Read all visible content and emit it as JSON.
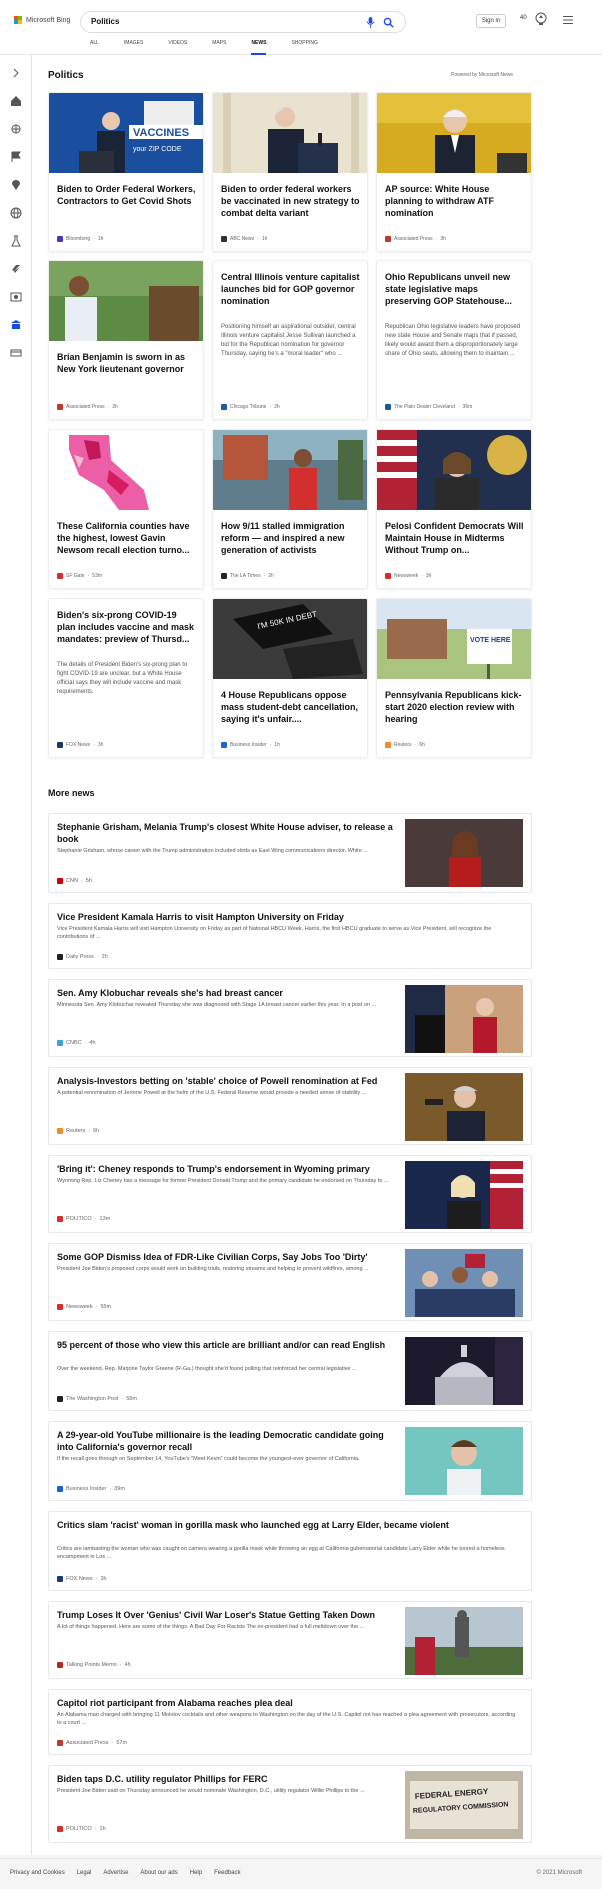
{
  "header": {
    "brand": "Microsoft Bing",
    "query": "Politics",
    "signin": "Sign in",
    "rewards": "40",
    "tabs": [
      "ALL",
      "IMAGES",
      "VIDEOS",
      "MAPS",
      "NEWS",
      "SHOPPING"
    ],
    "active_tab": "NEWS"
  },
  "section": {
    "title": "Politics",
    "powered": "Powered by Microsoft News"
  },
  "cards": [
    {
      "title": "Biden to Order Federal Workers, Contractors to Get Covid Shots",
      "source": "Bloomberg",
      "time": "1h",
      "color": "#4a38c9",
      "img": "vaccine",
      "snippet": ""
    },
    {
      "title": "Biden to order federal workers be vaccinated in new strategy to combat delta variant",
      "source": "ABC News",
      "time": "1h",
      "color": "#333",
      "img": "podium",
      "snippet": ""
    },
    {
      "title": "AP source: White House planning to withdraw ATF nomination",
      "source": "Associated Press",
      "time": "3h",
      "color": "#c0392b",
      "img": "gold",
      "snippet": ""
    },
    {
      "title": "Brian Benjamin is sworn in as New York lieutenant governor",
      "source": "Associated Press",
      "time": "2h",
      "color": "#c0392b",
      "img": "green",
      "snippet": ""
    },
    {
      "title": "Central Illinois venture capitalist launches bid for GOP governor nomination",
      "source": "Chicago Tribune",
      "time": "2h",
      "color": "#1e5aa8",
      "img": "",
      "snippet": "Positioning himself an aspirational outsider, central Illinois venture capitalist Jesse Sullivan launched a bid for the Republican nomination for governor Thursday, saying he's a \"moral leader\" who ..."
    },
    {
      "title": "Ohio Republicans unveil new state legislative maps preserving GOP Statehouse...",
      "source": "The Plain Dealer Cleveland",
      "time": "36m",
      "color": "#1e5aa8",
      "img": "",
      "snippet": "Republican Ohio legislative leaders have proposed new state House and Senate maps that if passed, likely would award them a disproportionately large share of Ohio seats, allowing them to maintain ..."
    },
    {
      "title": "These California counties have the highest, lowest Gavin Newsom recall election turno...",
      "source": "SF Gate",
      "time": "53m",
      "color": "#d62f2f",
      "img": "map",
      "snippet": ""
    },
    {
      "title": "How 9/11 stalled immigration reform — and inspired a new generation of activists",
      "source": "The LA Times",
      "time": "2h",
      "color": "#222",
      "img": "mural",
      "snippet": ""
    },
    {
      "title": "Pelosi Confident Democrats Will Maintain House in Midterms Without Trump on...",
      "source": "Newsweek",
      "time": "3h",
      "color": "#e0292b",
      "img": "flag",
      "snippet": ""
    },
    {
      "title": "Biden's six-prong COVID-19 plan includes vaccine and mask mandates: preview of Thursd...",
      "source": "FOX News",
      "time": "3h",
      "color": "#1b3a6b",
      "img": "",
      "snippet": "The details of President Biden's six-prong plan to fight COVID-19 are unclear, but a White House official says they will include vaccine and mask requirements."
    },
    {
      "title": "4 House Republicans oppose mass student-debt cancellation, saying it's unfair....",
      "source": "Business Insider",
      "time": "1h",
      "color": "#1d62d6",
      "img": "caps",
      "snippet": ""
    },
    {
      "title": "Pennsylvania Republicans kick-start 2020 election review with hearing",
      "source": "Reuters",
      "time": "6h",
      "color": "#f28c28",
      "img": "vote",
      "snippet": ""
    }
  ],
  "more_title": "More news",
  "rows": [
    {
      "title": "Stephanie Grisham, Melania Trump's closest White House adviser, to release a book",
      "snippet": "Stephanie Grisham, whose career with the Trump administration included stints as East Wing communications director, White ...",
      "source": "CNN",
      "time": "5h",
      "color": "#cc0000",
      "thumb": "grisham"
    },
    {
      "title": "Vice President Kamala Harris to visit Hampton University on Friday",
      "snippet": "Vice President Kamala Harris will visit Hampton University on Friday as part of National HBCU Week. Harris, the first HBCU graduate to serve as Vice President, will recognize the contributions of ...",
      "source": "Daily Press",
      "time": "2h",
      "color": "#222",
      "thumb": ""
    },
    {
      "title": "Sen. Amy Klobuchar reveals she's had breast cancer",
      "snippet": "Minnesota Sen. Amy Klobuchar revealed Thursday she was diagnosed with Stage 1A breast cancer earlier this year. In a post on ...",
      "source": "CNBC",
      "time": "4h",
      "color": "#3aa0e0",
      "thumb": "klobuchar"
    },
    {
      "title": "Analysis-Investors betting on 'stable' choice of Powell renomination at Fed",
      "snippet": "A potential renomination of Jerome Powell at the helm of the U.S. Federal Reserve would provide a needed sense of stability ...",
      "source": "Reuters",
      "time": "6h",
      "color": "#f28c28",
      "thumb": "powell"
    },
    {
      "title": "'Bring it': Cheney responds to Trump's endorsement in Wyoming primary",
      "snippet": "Wyoming Rep. Liz Cheney has a message for former President Donald Trump and the primary candidate he endorsed on Thursday to ...",
      "source": "POLITICO",
      "time": "13m",
      "color": "#d62f2f",
      "thumb": "cheney"
    },
    {
      "title": "Some GOP Dismiss Idea of FDR-Like Civilian Corps, Say Jobs Too 'Dirty'",
      "snippet": "President Joe Biden's proposed corps would work on building trails, restoring streams and helping to prevent wildfires, among ...",
      "source": "Newsweek",
      "time": "55m",
      "color": "#e0292b",
      "thumb": "crowd"
    },
    {
      "title": "95 percent of those who view this article are brilliant and/or can read English",
      "snippet": "Over the weekend, Rep. Marjorie Taylor Greene (R-Ga.) thought she'd found polling that reinforced her central legislative ...",
      "source": "The Washington Post",
      "time": "58m",
      "color": "#222",
      "thumb": "capitol"
    },
    {
      "title": "A 29-year-old YouTube millionaire is the leading Democratic candidate going into California's governor recall",
      "snippet": "If the recall goes through on September 14, YouTube's \"Meet Kevin\" could become the youngest-ever governor of California.",
      "source": "Business Insider",
      "time": "39m",
      "color": "#1d62d6",
      "thumb": "kevin"
    },
    {
      "title": "Critics slam 'racist' woman in gorilla mask who launched egg at Larry Elder, became violent",
      "snippet": "Critics are lambasting the woman who was caught on camera wearing a gorilla mask while throwing an egg at California gubernatorial candidate Larry Elder while he toured a homeless encampment in Los ...",
      "source": "FOX News",
      "time": "3h",
      "color": "#1b3a6b",
      "thumb": ""
    },
    {
      "title": "Trump Loses It Over 'Genius' Civil War Loser's Statue Getting Taken Down",
      "snippet": "A lot of things happened. Here are some of the things. A Bad Day For Racists The ex-president had a full meltdown over the ...",
      "source": "Talking Points Memo",
      "time": "4h",
      "color": "#b02a2a",
      "thumb": "statue"
    },
    {
      "title": "Capitol riot participant from Alabama reaches plea deal",
      "snippet": "An Alabama man charged with bringing 11 Molotov cocktails and other weapons to Washington on the day of the U.S. Capitol riot has reached a plea agreement with prosecutors, according to a court ...",
      "source": "Associated Press",
      "time": "57m",
      "color": "#c0392b",
      "thumb": ""
    },
    {
      "title": "Biden taps D.C. utility regulator Phillips for FERC",
      "snippet": "President Joe Biden said on Thursday announced he would nominate Washington, D.C., utility regulator Willie Phillips to the ...",
      "source": "POLITICO",
      "time": "1h",
      "color": "#d62f2f",
      "thumb": "ferc"
    }
  ],
  "images": {
    "vaccine_text": "VACCINES",
    "vaccine_sub": "your ZIP CODE",
    "vote_text": "VOTE HERE",
    "ferc_text": "FEDERAL ENERGY REGULATORY COMMISSION",
    "caps_text": "I'M 50K IN DEBT"
  },
  "footer": {
    "links": [
      "Privacy and Cookies",
      "Legal",
      "Advertise",
      "About our ads",
      "Help",
      "Feedback"
    ],
    "copyright": "© 2021 Microsoft"
  }
}
